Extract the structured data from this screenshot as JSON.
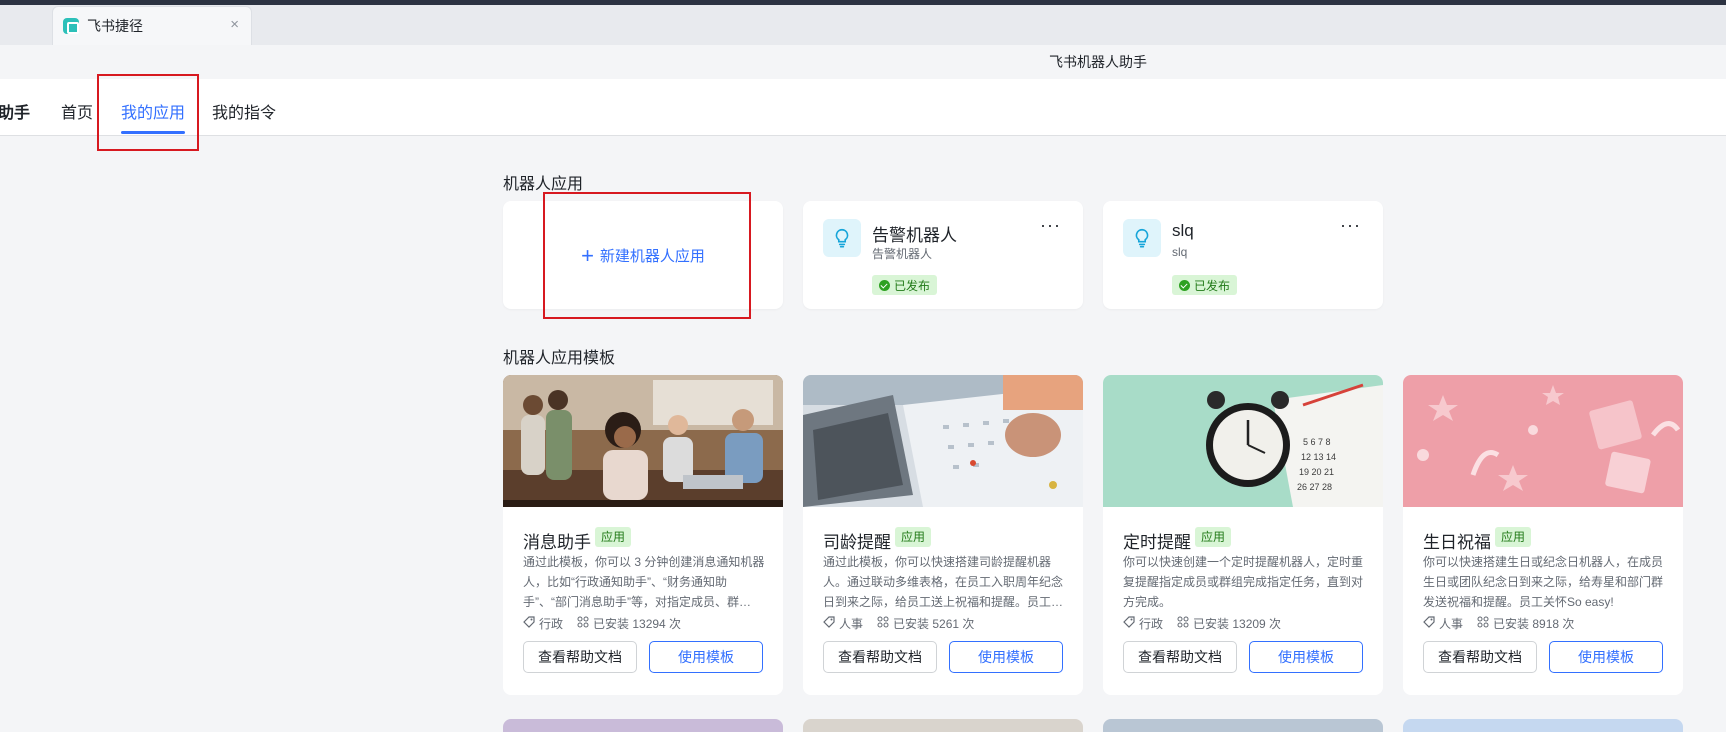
{
  "browser": {
    "tab_title": "飞书捷径",
    "tab_close": "×",
    "window_title": "飞书机器人助手"
  },
  "nav": {
    "brand": "助手",
    "items": [
      "首页",
      "我的应用",
      "我的指令"
    ],
    "active_item": "我的应用"
  },
  "bot_apps": {
    "section_title": "机器人应用",
    "new_label": "新建机器人应用",
    "new_icon": "plus-icon",
    "cards": [
      {
        "name": "告警机器人",
        "subtitle": "告警机器人",
        "status": "已发布",
        "more": "···",
        "icon": "lightbulb-icon"
      },
      {
        "name": "slq",
        "subtitle": "slq",
        "status": "已发布",
        "more": "···",
        "icon": "lightbulb-icon"
      }
    ]
  },
  "templates": {
    "section_title": "机器人应用模板",
    "doc_button": "查看帮助文档",
    "use_button": "使用模板",
    "tag_icon": "tag-icon",
    "installs_icon": "apps-icon",
    "items": [
      {
        "title": "消息助手",
        "tag": "应用",
        "description": "通过此模板，你可以 3 分钟创建消息通知机器人，比如“行政通知助手”、“财务通知助手”、“部门消息助手”等，对指定成员、群…",
        "category": "行政",
        "installs": "已安装 13294 次",
        "image": "team-meeting-photo"
      },
      {
        "title": "司龄提醒",
        "tag": "应用",
        "description": "通过此模板，你可以快速搭建司龄提醒机器人。通过联动多维表格，在员工入职周年纪念日到来之际，给员工送上祝福和提醒。员工…",
        "category": "人事",
        "installs": "已安装 5261 次",
        "image": "calendar-laptop-photo"
      },
      {
        "title": "定时提醒",
        "tag": "应用",
        "description": "你可以快速创建一个定时提醒机器人，定时重复提醒指定成员或群组完成指定任务，直到对方完成。",
        "category": "行政",
        "installs": "已安装 13209 次",
        "image": "alarm-clock-photo"
      },
      {
        "title": "生日祝福",
        "tag": "应用",
        "description": "你可以快速搭建生日或纪念日机器人，在成员生日或团队纪念日到来之际，给寿星和部门群发送祝福和提醒。员工关怀So easy!",
        "category": "人事",
        "installs": "已安装 8918 次",
        "image": "birthday-gifts-photo"
      }
    ]
  },
  "colors": {
    "accent": "#3370ff",
    "published_bg": "#d9f5d6",
    "published_text": "#237b19",
    "highlight_box": "#d71920"
  }
}
